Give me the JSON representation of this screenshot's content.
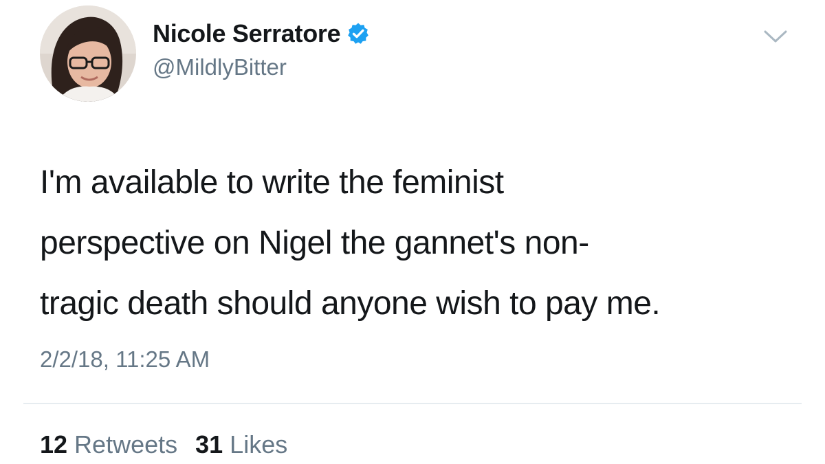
{
  "author": {
    "display_name": "Nicole Serratore",
    "handle": "@MildlyBitter",
    "verified": true,
    "avatar_icon": "profile-photo"
  },
  "tweet": {
    "text_lines": [
      "I'm available to write the feminist",
      "perspective on Nigel the gannet's non-",
      "tragic death should anyone wish to pay me."
    ],
    "timestamp": "2/2/18, 11:25 AM"
  },
  "stats": {
    "retweets_count": "12",
    "retweets_label": "Retweets",
    "likes_count": "31",
    "likes_label": "Likes"
  },
  "icons": {
    "verified": "verified-badge-icon",
    "menu": "chevron-down-icon"
  },
  "colors": {
    "text_primary": "#14171a",
    "text_secondary": "#657786",
    "verified_blue": "#1da1f2",
    "divider": "#e6ecf0"
  }
}
